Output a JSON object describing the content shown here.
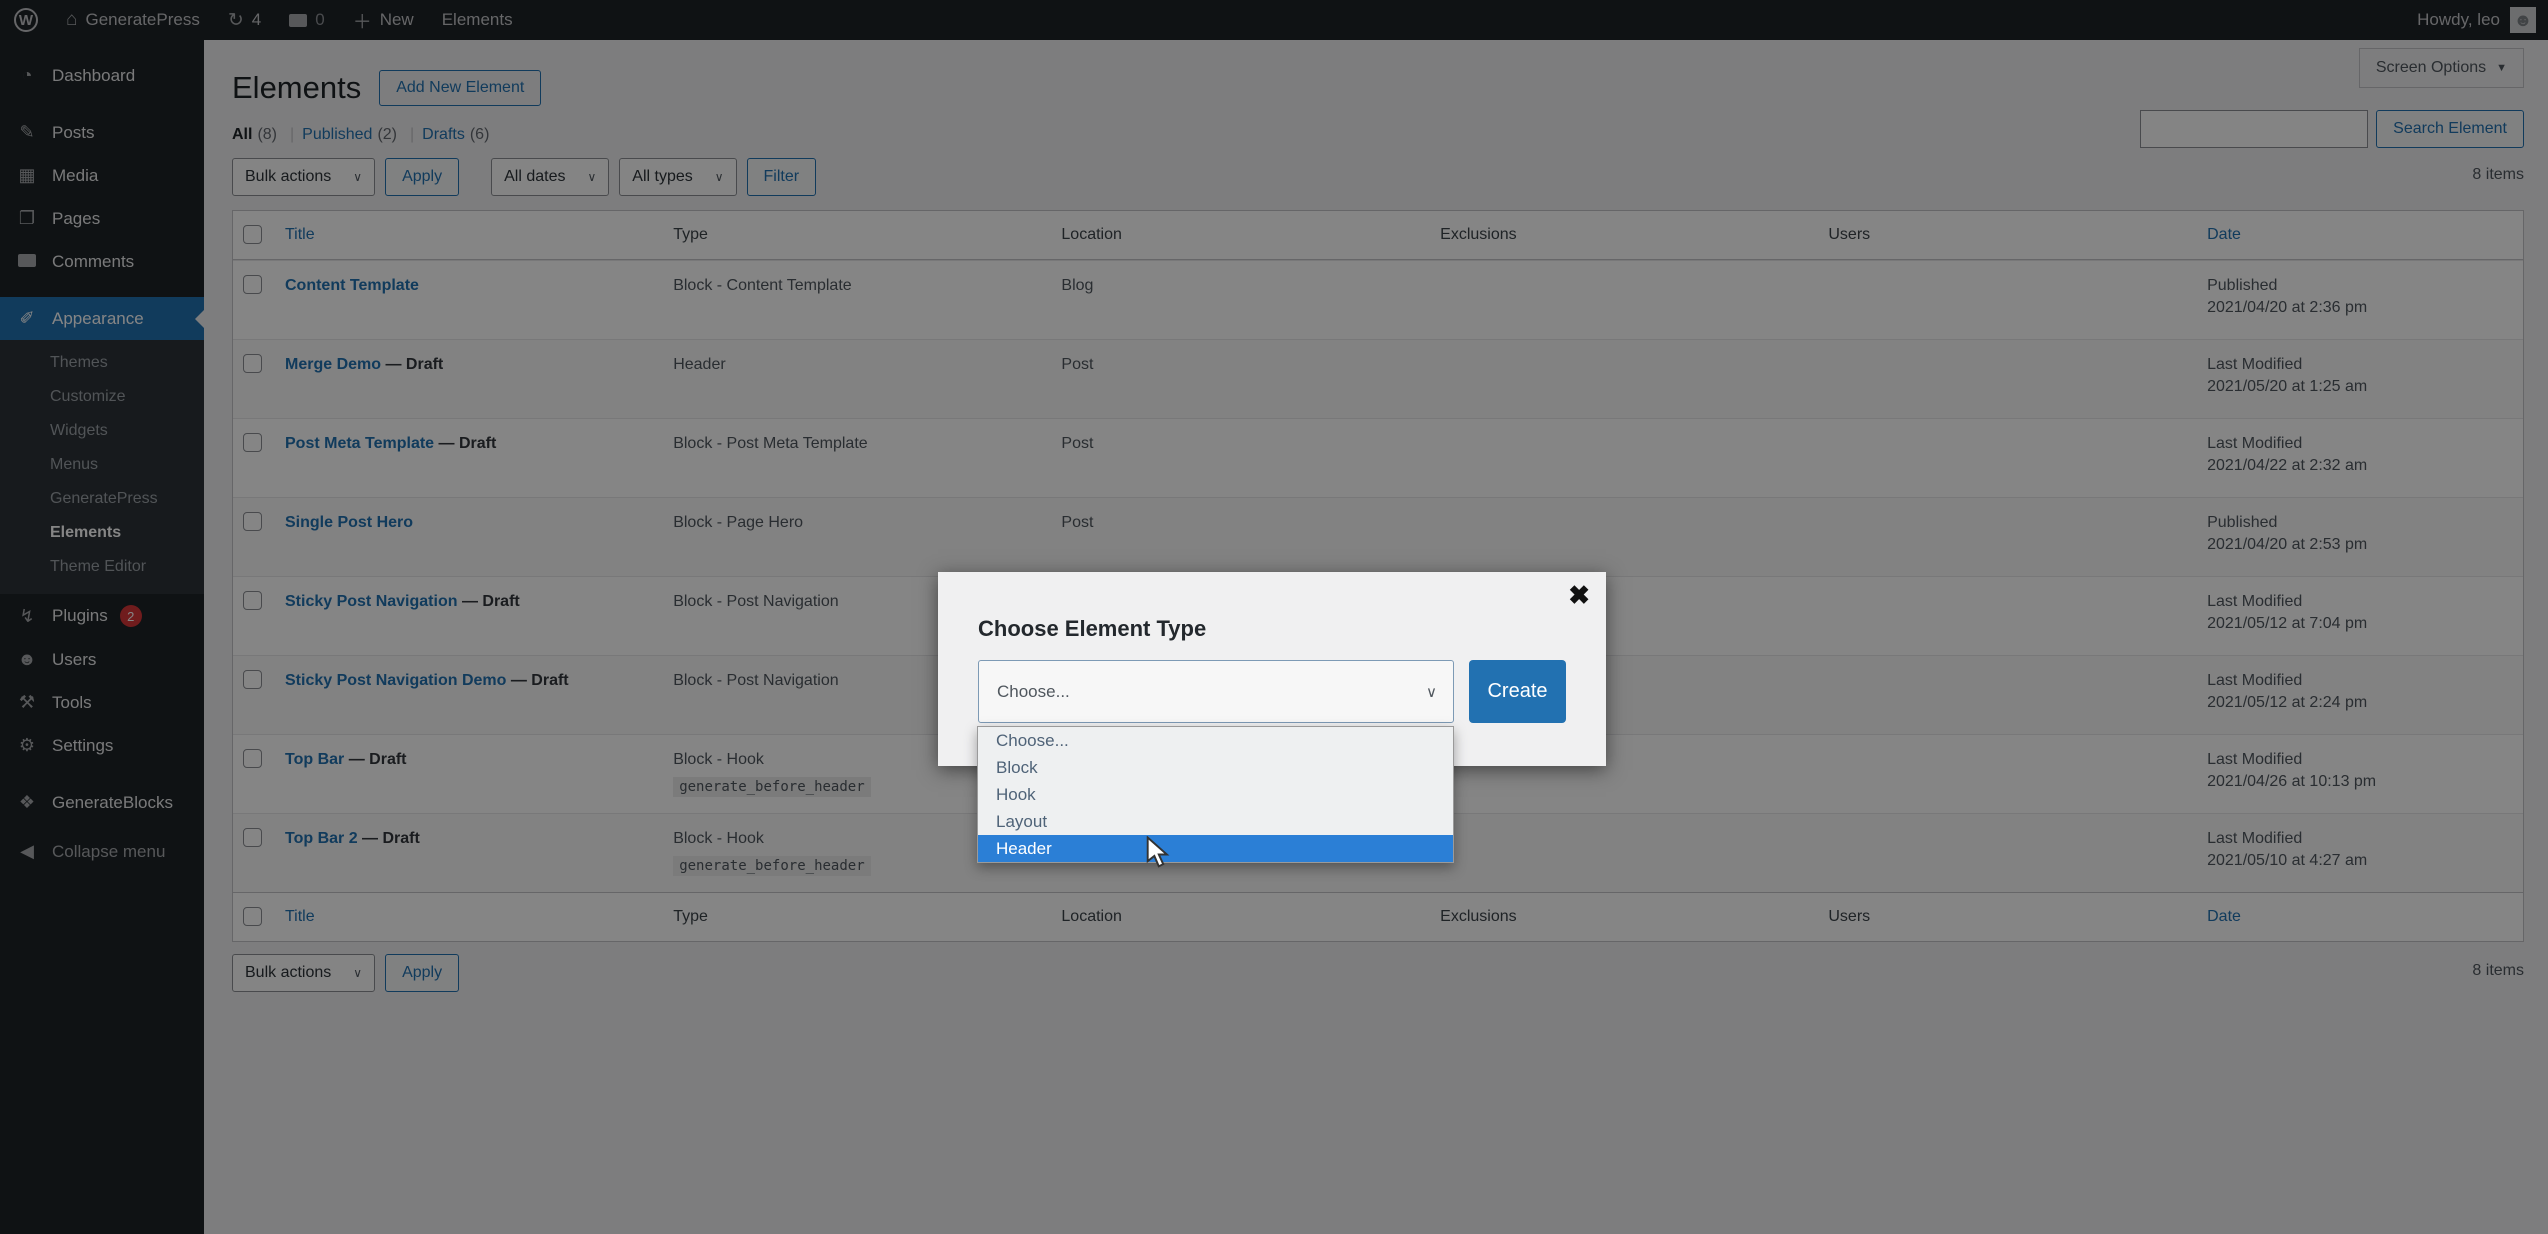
{
  "admin_bar": {
    "wp_logo": "W",
    "site_name": "GeneratePress",
    "updates_count": "4",
    "comments_count": "0",
    "new_label": "New",
    "page_label": "Elements",
    "howdy": "Howdy, leo"
  },
  "sidebar": {
    "items": [
      {
        "label": "Dashboard"
      },
      {
        "label": "Posts"
      },
      {
        "label": "Media"
      },
      {
        "label": "Pages"
      },
      {
        "label": "Comments"
      },
      {
        "label": "Appearance"
      },
      {
        "label": "Plugins",
        "badge": "2"
      },
      {
        "label": "Users"
      },
      {
        "label": "Tools"
      },
      {
        "label": "Settings"
      },
      {
        "label": "GenerateBlocks"
      },
      {
        "label": "Collapse menu"
      }
    ],
    "appearance_submenu": [
      "Themes",
      "Customize",
      "Widgets",
      "Menus",
      "GeneratePress",
      "Elements",
      "Theme Editor"
    ]
  },
  "page": {
    "title": "Elements",
    "add_new_button": "Add New Element",
    "screen_options": "Screen Options",
    "search_button": "Search Element",
    "items_count": "8 items",
    "filters": {
      "all": "All",
      "all_count": "(8)",
      "published": "Published",
      "published_count": "(2)",
      "drafts": "Drafts",
      "drafts_count": "(6)"
    },
    "toolbar": {
      "bulk_actions": "Bulk actions",
      "apply": "Apply",
      "all_dates": "All dates",
      "all_types": "All types",
      "filter": "Filter"
    }
  },
  "table": {
    "columns": [
      "Title",
      "Type",
      "Location",
      "Exclusions",
      "Users",
      "Date"
    ],
    "rows": [
      {
        "title": "Content Template",
        "suffix": "",
        "type": "Block - Content Template",
        "type_code": "",
        "location": "Blog",
        "date_status": "Published",
        "date_value": "2021/04/20 at 2:36 pm"
      },
      {
        "title": "Merge Demo",
        "suffix": " — Draft",
        "type": "Header",
        "type_code": "",
        "location": "Post",
        "date_status": "Last Modified",
        "date_value": "2021/05/20 at 1:25 am"
      },
      {
        "title": "Post Meta Template",
        "suffix": " — Draft",
        "type": "Block - Post Meta Template",
        "type_code": "",
        "location": "Post",
        "date_status": "Last Modified",
        "date_value": "2021/04/22 at 2:32 am"
      },
      {
        "title": "Single Post Hero",
        "suffix": "",
        "type": "Block - Page Hero",
        "type_code": "",
        "location": "Post",
        "date_status": "Published",
        "date_value": "2021/04/20 at 2:53 pm"
      },
      {
        "title": "Sticky Post Navigation",
        "suffix": " — Draft",
        "type": "Block - Post Navigation",
        "type_code": "",
        "location": "",
        "date_status": "Last Modified",
        "date_value": "2021/05/12 at 7:04 pm"
      },
      {
        "title": "Sticky Post Navigation Demo",
        "suffix": " — Draft",
        "type": "Block - Post Navigation",
        "type_code": "",
        "location": "",
        "date_status": "Last Modified",
        "date_value": "2021/05/12 at 2:24 pm"
      },
      {
        "title": "Top Bar",
        "suffix": " — Draft",
        "type": "Block - Hook",
        "type_code": "generate_before_header",
        "location": "",
        "date_status": "Last Modified",
        "date_value": "2021/04/26 at 10:13 pm"
      },
      {
        "title": "Top Bar 2",
        "suffix": " — Draft",
        "type": "Block - Hook",
        "type_code": "generate_before_header",
        "location": "",
        "date_status": "Last Modified",
        "date_value": "2021/05/10 at 4:27 am"
      }
    ]
  },
  "modal": {
    "title": "Choose Element Type",
    "close": "✖",
    "select_value": "Choose...",
    "create_button": "Create",
    "options": [
      "Choose...",
      "Block",
      "Hook",
      "Layout",
      "Header"
    ],
    "highlighted_option": "Header"
  },
  "colors": {
    "accent": "#2271b1",
    "option_highlight": "#2b7fd6",
    "plugins_badge": "#d63638",
    "admin_dark": "#1d2327"
  }
}
